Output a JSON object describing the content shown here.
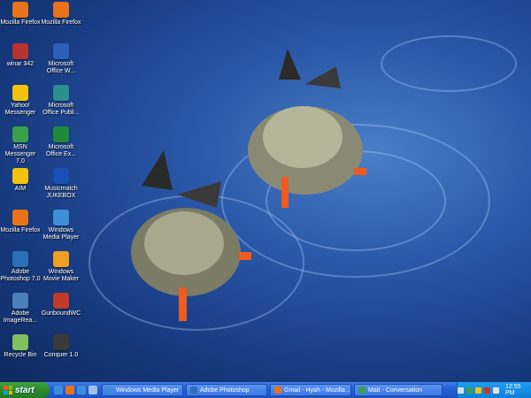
{
  "desktop": {
    "icons_left": [
      {
        "label": "Mozilla Firefox",
        "icon": "firefox-icon",
        "color": "#e8731a"
      },
      {
        "label": "winar 342",
        "icon": "winrar-icon",
        "color": "#b8332f"
      },
      {
        "label": "Yahoo! Messenger",
        "icon": "yahoo-messenger-icon",
        "color": "#f2c20f"
      },
      {
        "label": "MSN Messenger 7.0",
        "icon": "msn-messenger-icon",
        "color": "#3aa14a"
      },
      {
        "label": "AIM",
        "icon": "aim-icon",
        "color": "#f2c20f"
      },
      {
        "label": "Mozilla Firefox",
        "icon": "firefox-icon",
        "color": "#e8731a"
      },
      {
        "label": "Adobe Photoshop 7.0",
        "icon": "photoshop-icon",
        "color": "#2b6fb6"
      },
      {
        "label": "Adobe ImageRea...",
        "icon": "imageready-icon",
        "color": "#4b7fbe"
      },
      {
        "label": "Recycle Bin",
        "icon": "recycle-bin-icon",
        "color": "#7fbf5f"
      }
    ],
    "icons_right": [
      {
        "label": "Mozilla Firefox",
        "icon": "firefox-icon",
        "color": "#e8731a"
      },
      {
        "label": "Microsoft Office W...",
        "icon": "word-icon",
        "color": "#2b5fb8"
      },
      {
        "label": "Microsoft Office Publi...",
        "icon": "publisher-icon",
        "color": "#2c8f8f"
      },
      {
        "label": "Microsoft Office Ex...",
        "icon": "excel-icon",
        "color": "#1f8a3a"
      },
      {
        "label": "Musicmatch JUKEBOX",
        "icon": "musicmatch-icon",
        "color": "#1c4fb8"
      },
      {
        "label": "Windows Media Player",
        "icon": "media-player-icon",
        "color": "#3f8fd8"
      },
      {
        "label": "Windows Movie Maker",
        "icon": "movie-maker-icon",
        "color": "#f0a020"
      },
      {
        "label": "GunboundWC",
        "icon": "gunbound-icon",
        "color": "#c23a2a"
      },
      {
        "label": "Conquer 1.0",
        "icon": "conquer-icon",
        "color": "#3a3a3a"
      }
    ]
  },
  "taskbar": {
    "start_label": "start",
    "quick_launch": [
      {
        "icon": "ie-icon",
        "color": "#3a8fe0"
      },
      {
        "icon": "firefox-icon",
        "color": "#e8731a"
      },
      {
        "icon": "media-player-icon",
        "color": "#3f8fd8"
      },
      {
        "icon": "show-desktop-icon",
        "color": "#9fc0ea"
      }
    ],
    "tasks": [
      {
        "label": "Windows Media Player",
        "icon": "media-player-icon",
        "color": "#3f8fd8"
      },
      {
        "label": "Adobe Photoshop",
        "icon": "photoshop-icon",
        "color": "#2b6fb6"
      },
      {
        "label": "Gmail - Hyah - Mozilla ...",
        "icon": "firefox-icon",
        "color": "#e8731a"
      },
      {
        "label": "Matt - Conversation",
        "icon": "msn-messenger-icon",
        "color": "#3aa14a"
      }
    ],
    "tray_icons": [
      {
        "icon": "network-icon",
        "color": "#cfe6ff"
      },
      {
        "icon": "msn-tray-icon",
        "color": "#3aa14a"
      },
      {
        "icon": "yahoo-tray-icon",
        "color": "#f2c20f"
      },
      {
        "icon": "antivirus-tray-icon",
        "color": "#c23a2a"
      },
      {
        "icon": "volume-icon",
        "color": "#e0e0e0"
      }
    ],
    "clock": "12:55 PM"
  }
}
